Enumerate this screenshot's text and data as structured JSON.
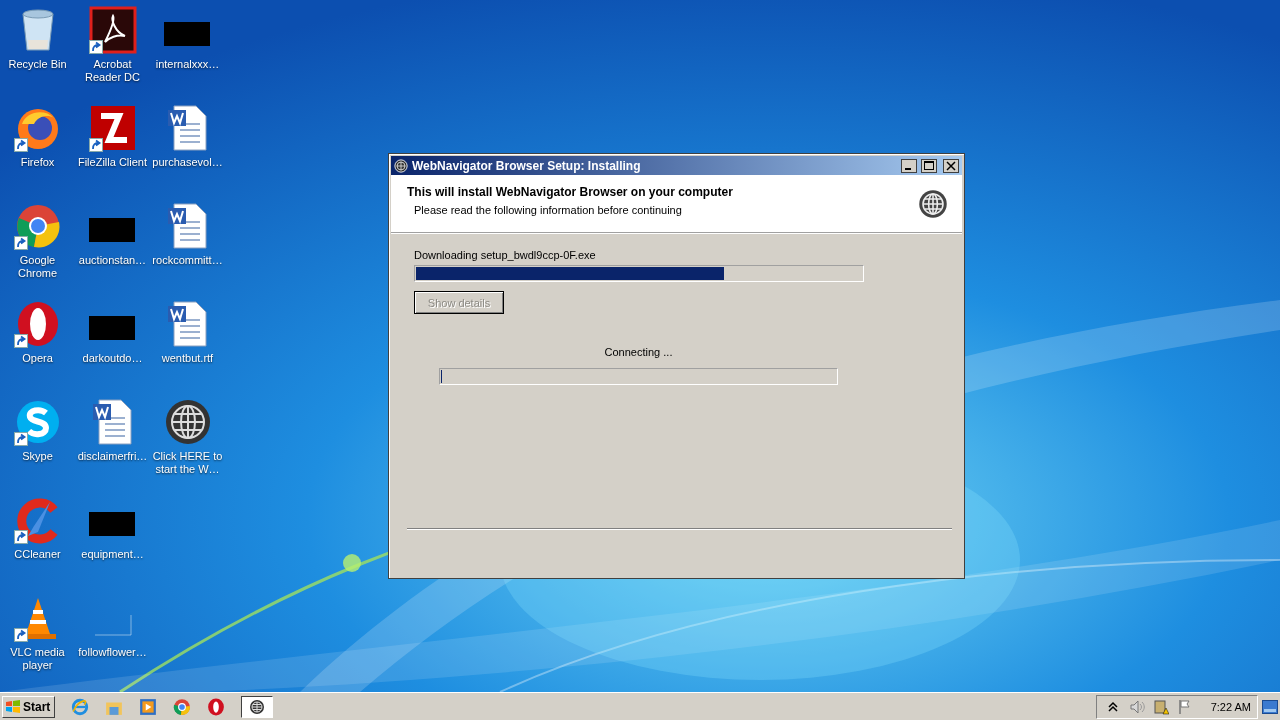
{
  "desktop": {
    "icons": [
      {
        "label": "Recycle Bin",
        "kind": "recycle",
        "shortcut": false
      },
      {
        "label": "Firefox",
        "kind": "firefox",
        "shortcut": true
      },
      {
        "label": "Google Chrome",
        "kind": "chrome",
        "shortcut": true
      },
      {
        "label": "Opera",
        "kind": "opera",
        "shortcut": true
      },
      {
        "label": "Skype",
        "kind": "skype",
        "shortcut": true
      },
      {
        "label": "CCleaner",
        "kind": "ccleaner",
        "shortcut": true
      },
      {
        "label": "VLC media player",
        "kind": "vlc",
        "shortcut": true
      },
      {
        "label": "Acrobat Reader DC",
        "kind": "acrobat",
        "shortcut": true
      },
      {
        "label": "FileZilla Client",
        "kind": "filezilla",
        "shortcut": true
      },
      {
        "label": "auctionstan…",
        "kind": "redacted",
        "shortcut": false
      },
      {
        "label": "darkoutdo…",
        "kind": "redacted",
        "shortcut": false
      },
      {
        "label": "disclaimerfri…",
        "kind": "document",
        "shortcut": false
      },
      {
        "label": "equipment…",
        "kind": "redacted",
        "shortcut": false
      },
      {
        "label": "followflower…",
        "kind": "blank",
        "shortcut": false
      },
      {
        "label": "internalxxx…",
        "kind": "redacted",
        "shortcut": false
      },
      {
        "label": "purchasevol…",
        "kind": "document",
        "shortcut": false
      },
      {
        "label": "rockcommitt…",
        "kind": "document",
        "shortcut": false
      },
      {
        "label": "wentbut.rtf",
        "kind": "document",
        "shortcut": false
      },
      {
        "label": "Click HERE to start the W…",
        "kind": "globe",
        "shortcut": false
      }
    ]
  },
  "window": {
    "title": "WebNavigator Browser Setup: Installing",
    "heading": "This will install WebNavigator Browser on your computer",
    "subheading": "Please read the following information before continuing",
    "download_label": "Downloading setup_bwdl9ccp-0F.exe",
    "download_progress": {
      "level": 0.69
    },
    "details_button": {
      "label": "Show details",
      "disabled": true
    },
    "status": "Connecting ...",
    "status_progress": {
      "level": 0
    }
  },
  "taskbar": {
    "start": "Start",
    "quick_launch": [
      {
        "kind": "ie"
      },
      {
        "kind": "folder"
      },
      {
        "kind": "media"
      },
      {
        "kind": "chrome"
      },
      {
        "kind": "opera"
      }
    ],
    "tasks": [
      {
        "kind": "globe",
        "selected": true
      }
    ],
    "tray": [
      {
        "kind": "chevron"
      },
      {
        "kind": "speaker"
      },
      {
        "kind": "network"
      },
      {
        "kind": "flag"
      }
    ],
    "clock": "7:22 AM"
  }
}
